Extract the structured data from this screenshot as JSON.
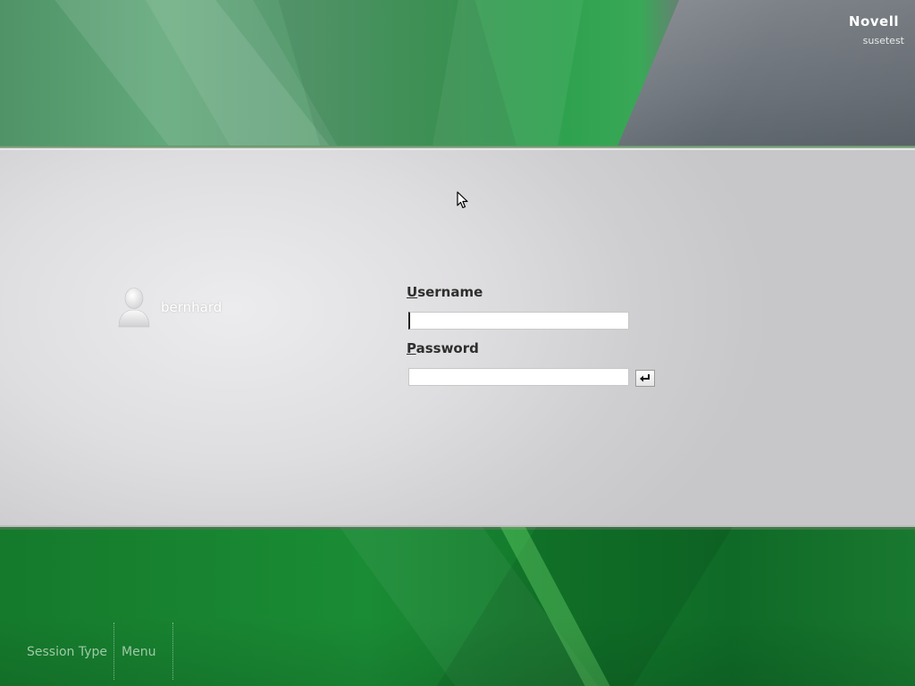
{
  "header": {
    "brand": "Novell",
    "hostname": "susetest"
  },
  "users": [
    {
      "name": "bernhard",
      "icon": "user-avatar-icon"
    }
  ],
  "login_form": {
    "username_label_mnemonic": "U",
    "username_label_rest": "sername",
    "username_value": "",
    "password_label_mnemonic": "P",
    "password_label_rest": "assword",
    "password_value": "",
    "submit_icon": "return-arrow-icon"
  },
  "footer": {
    "session_type_label": "Session Type",
    "menu_label": "Menu"
  },
  "colors": {
    "green": "#1a8c35",
    "panel_grey": "#dedde0",
    "label_text": "#2e2e2e",
    "footer_text": "#9fc9a7"
  }
}
